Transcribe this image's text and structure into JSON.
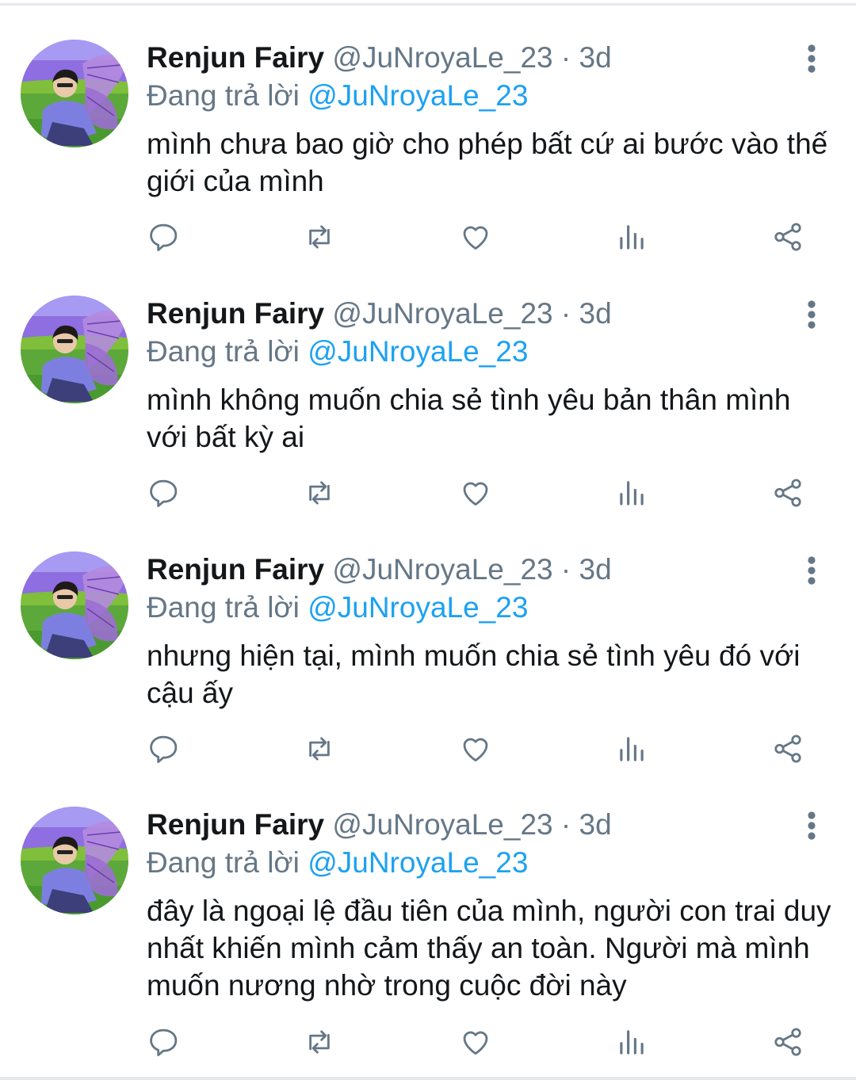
{
  "tweets": [
    {
      "name": "Renjun Fairy",
      "handle": "@JuNroyaLe_23",
      "separator": "·",
      "time": "3d",
      "replying_label": "Đang trả lời",
      "replying_to": "@JuNroyaLe_23",
      "text": "mình chưa bao giờ cho phép bất cứ ai bước vào thế giới của mình"
    },
    {
      "name": "Renjun Fairy",
      "handle": "@JuNroyaLe_23",
      "separator": "·",
      "time": "3d",
      "replying_label": "Đang trả lời",
      "replying_to": "@JuNroyaLe_23",
      "text": "mình không muốn chia sẻ tình yêu bản thân mình với bất kỳ ai"
    },
    {
      "name": "Renjun Fairy",
      "handle": "@JuNroyaLe_23",
      "separator": "·",
      "time": "3d",
      "replying_label": "Đang trả lời",
      "replying_to": "@JuNroyaLe_23",
      "text": "nhưng hiện tại, mình muốn chia sẻ tình yêu đó với cậu ấy"
    },
    {
      "name": "Renjun Fairy",
      "handle": "@JuNroyaLe_23",
      "separator": "·",
      "time": "3d",
      "replying_label": "Đang trả lời",
      "replying_to": "@JuNroyaLe_23",
      "text": "đây là ngoại lệ đầu tiên của mình, người con trai duy nhất khiến mình cảm thấy an toàn. Người mà mình muốn nương nhờ trong cuộc đời này"
    }
  ],
  "icons": {
    "reply": "reply-icon",
    "retweet": "retweet-icon",
    "like": "heart-icon",
    "analytics": "analytics-icon",
    "share": "share-icon",
    "more": "more-options-icon"
  },
  "colors": {
    "text": "#14171a",
    "secondary": "#657786",
    "link": "#1da1f2",
    "divider": "#e6e9ec"
  }
}
